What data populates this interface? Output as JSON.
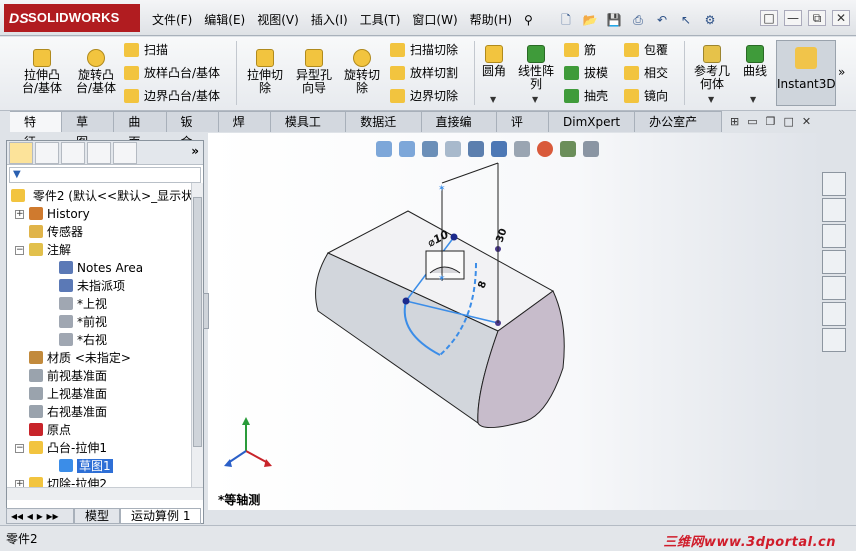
{
  "app": {
    "logo_text": "SOLIDWORKS",
    "logo_prefix": "DS"
  },
  "menu": [
    "文件(F)",
    "编辑(E)",
    "视图(V)",
    "插入(I)",
    "工具(T)",
    "窗口(W)",
    "帮助(H)"
  ],
  "quick_access": [
    "new-icon",
    "open-icon",
    "save-icon",
    "print-icon",
    "undo-icon",
    "select-icon",
    "rebuild-icon"
  ],
  "window_buttons": [
    "□",
    "—",
    "⧉",
    "✕"
  ],
  "ribbon": {
    "big": [
      {
        "label": "拉伸凸\n台/基体",
        "icon": "extruded-boss-icon"
      },
      {
        "label": "旋转凸\n台/基体",
        "icon": "revolved-boss-icon"
      },
      {
        "label": "拉伸切\n除",
        "icon": "extruded-cut-icon"
      },
      {
        "label": "异型孔\n向导",
        "icon": "hole-wizard-icon"
      },
      {
        "label": "旋转切\n除",
        "icon": "revolved-cut-icon"
      },
      {
        "label": "圆角",
        "icon": "fillet-icon"
      },
      {
        "label": "线性阵\n列",
        "icon": "linear-pattern-icon"
      },
      {
        "label": "参考几\n何体",
        "icon": "reference-geometry-icon"
      },
      {
        "label": "曲线",
        "icon": "curves-icon"
      }
    ],
    "small": [
      {
        "label": "扫描",
        "icon": "sweep-icon"
      },
      {
        "label": "放样凸台/基体",
        "icon": "loft-icon"
      },
      {
        "label": "边界凸台/基体",
        "icon": "boundary-boss-icon"
      },
      {
        "label": "扫描切除",
        "icon": "swept-cut-icon"
      },
      {
        "label": "放样切割",
        "icon": "lofted-cut-icon"
      },
      {
        "label": "边界切除",
        "icon": "boundary-cut-icon"
      },
      {
        "label": "筋",
        "icon": "rib-icon"
      },
      {
        "label": "拔模",
        "icon": "draft-icon"
      },
      {
        "label": "抽壳",
        "icon": "shell-icon"
      },
      {
        "label": "包覆",
        "icon": "wrap-icon"
      },
      {
        "label": "相交",
        "icon": "intersect-icon"
      },
      {
        "label": "镜向",
        "icon": "mirror-icon"
      }
    ],
    "instant3d": "Instant3D",
    "more": "»"
  },
  "tabs": [
    "特征",
    "草图",
    "曲面",
    "钣金",
    "焊件",
    "模具工具",
    "数据迁移",
    "直接编辑",
    "评估",
    "DimXpert",
    "办公室产品"
  ],
  "active_tab": "特征",
  "tree": {
    "root": "零件2 (默认<<默认>_显示状",
    "items": [
      {
        "label": "History",
        "icon": "history-icon",
        "level": 1,
        "expander": "+"
      },
      {
        "label": "传感器",
        "icon": "sensors-icon",
        "level": 1,
        "expander": ""
      },
      {
        "label": "注解",
        "icon": "annotations-icon",
        "level": 1,
        "expander": "−"
      },
      {
        "label": "Notes Area",
        "icon": "notes-area-icon",
        "level": 2,
        "expander": ""
      },
      {
        "label": "未指派项",
        "icon": "unassigned-items-icon",
        "level": 2,
        "expander": ""
      },
      {
        "label": "*上视",
        "icon": "annotation-view-icon",
        "level": 2,
        "expander": ""
      },
      {
        "label": "*前视",
        "icon": "annotation-view-icon",
        "level": 2,
        "expander": ""
      },
      {
        "label": "*右视",
        "icon": "annotation-view-icon",
        "level": 2,
        "expander": ""
      },
      {
        "label": "材质 <未指定>",
        "icon": "material-icon",
        "level": 1,
        "expander": ""
      },
      {
        "label": "前视基准面",
        "icon": "plane-icon",
        "level": 1,
        "expander": ""
      },
      {
        "label": "上视基准面",
        "icon": "plane-icon",
        "level": 1,
        "expander": ""
      },
      {
        "label": "右视基准面",
        "icon": "plane-icon",
        "level": 1,
        "expander": ""
      },
      {
        "label": "原点",
        "icon": "origin-icon",
        "level": 1,
        "expander": ""
      },
      {
        "label": "凸台-拉伸1",
        "icon": "boss-extrude-icon",
        "level": 1,
        "expander": "−"
      },
      {
        "label": "草图1",
        "icon": "sketch-icon",
        "level": 2,
        "expander": "",
        "selected": true
      },
      {
        "label": "切除-拉伸2",
        "icon": "cut-extrude-icon",
        "level": 1,
        "expander": "+"
      }
    ]
  },
  "bottom_tabs": [
    "模型",
    "运动算例 1"
  ],
  "view_label": "*等轴测",
  "model": {
    "dim_diameter": "⌀10",
    "dim_vertical": "30",
    "dim_side": "8"
  },
  "status": {
    "text": "零件2",
    "watermark": "三维网www.3dportal.cn"
  },
  "colors": {
    "logo_red": "#b11c20",
    "selection_blue": "#2e6fd6",
    "sketch_blue": "#3b8de8",
    "dimension_navy": "#1c2a8c"
  }
}
